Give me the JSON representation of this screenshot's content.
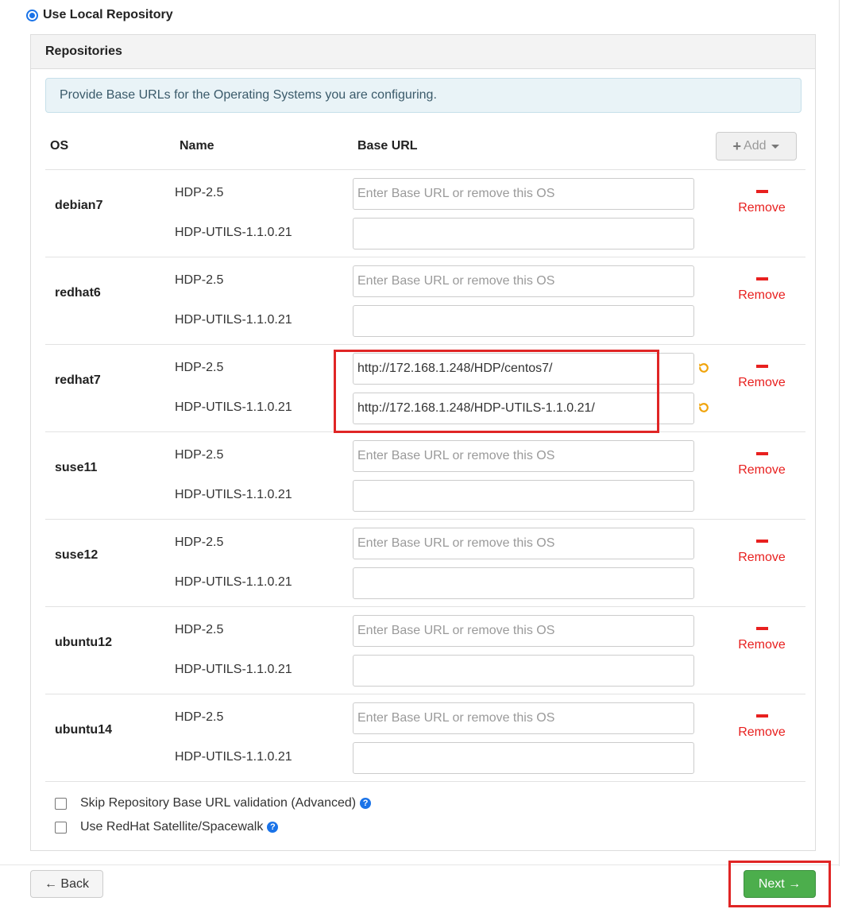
{
  "repo_choice": {
    "label": "Use Local Repository",
    "selected": true
  },
  "panel": {
    "title": "Repositories"
  },
  "alert": {
    "text": "Provide Base URLs for the Operating Systems you are configuring."
  },
  "table": {
    "headers": {
      "os": "OS",
      "name": "Name",
      "base_url": "Base URL"
    },
    "add_button": {
      "icon": "plus-icon",
      "label": "Add"
    },
    "url_placeholder": "Enter Base URL or remove this OS",
    "remove_label": "Remove",
    "rows": [
      {
        "os": "debian7",
        "repos": [
          {
            "name": "HDP-2.5",
            "value": "",
            "placeholder": "Enter Base URL or remove this OS"
          },
          {
            "name": "HDP-UTILS-1.1.0.21",
            "value": "",
            "placeholder": ""
          }
        ]
      },
      {
        "os": "redhat6",
        "repos": [
          {
            "name": "HDP-2.5",
            "value": "",
            "placeholder": "Enter Base URL or remove this OS"
          },
          {
            "name": "HDP-UTILS-1.1.0.21",
            "value": "",
            "placeholder": ""
          }
        ]
      },
      {
        "os": "redhat7",
        "repos": [
          {
            "name": "HDP-2.5",
            "value": "http://172.168.1.248/HDP/centos7/",
            "placeholder": ""
          },
          {
            "name": "HDP-UTILS-1.1.0.21",
            "value": "http://172.168.1.248/HDP-UTILS-1.1.0.21/",
            "placeholder": ""
          }
        ],
        "undo_icons": true
      },
      {
        "os": "suse11",
        "repos": [
          {
            "name": "HDP-2.5",
            "value": "",
            "placeholder": "Enter Base URL or remove this OS"
          },
          {
            "name": "HDP-UTILS-1.1.0.21",
            "value": "",
            "placeholder": ""
          }
        ]
      },
      {
        "os": "suse12",
        "repos": [
          {
            "name": "HDP-2.5",
            "value": "",
            "placeholder": "Enter Base URL or remove this OS"
          },
          {
            "name": "HDP-UTILS-1.1.0.21",
            "value": "",
            "placeholder": ""
          }
        ]
      },
      {
        "os": "ubuntu12",
        "repos": [
          {
            "name": "HDP-2.5",
            "value": "",
            "placeholder": "Enter Base URL or remove this OS"
          },
          {
            "name": "HDP-UTILS-1.1.0.21",
            "value": "",
            "placeholder": ""
          }
        ]
      },
      {
        "os": "ubuntu14",
        "repos": [
          {
            "name": "HDP-2.5",
            "value": "",
            "placeholder": "Enter Base URL or remove this OS"
          },
          {
            "name": "HDP-UTILS-1.1.0.21",
            "value": "",
            "placeholder": ""
          }
        ]
      }
    ]
  },
  "options": {
    "skip_validation": {
      "label": "Skip Repository Base URL validation (Advanced)",
      "checked": false
    },
    "satellite": {
      "label": "Use RedHat Satellite/Spacewalk",
      "checked": false
    }
  },
  "nav": {
    "back_label": "← Back",
    "next_label": "Next →"
  },
  "colors": {
    "primary": "#1a73e8",
    "danger": "#e8201f",
    "success": "#4cae4c",
    "highlight": "#e02525",
    "undo": "#f0a30a"
  }
}
